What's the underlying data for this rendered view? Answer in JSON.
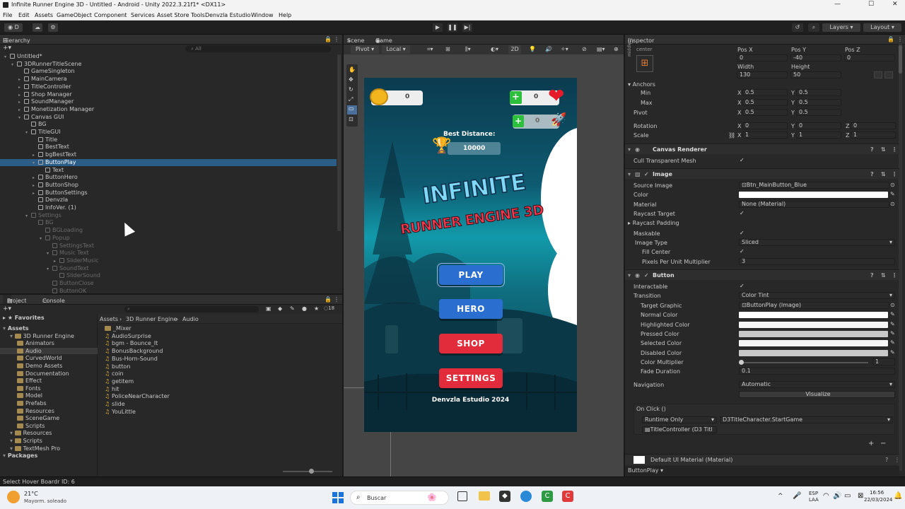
{
  "window": {
    "title": "Infinite Runner Engine 3D - Untitled - Android - Unity 2022.3.21f1* <DX11>"
  },
  "menu": [
    "File",
    "Edit",
    "Assets",
    "GameObject",
    "Component",
    "Services",
    "Asset Store Tools",
    "Denvzla Estudio",
    "Window",
    "Help"
  ],
  "toolbar": {
    "account_label": "D",
    "layers_label": "Layers",
    "layout_label": "Layout"
  },
  "hierarchy": {
    "tab": "Hierarchy",
    "search_placeholder": "All",
    "rows": [
      {
        "label": "Untitled*",
        "indent": 0,
        "arrow": "▾",
        "state": "normal"
      },
      {
        "label": "3DRunnerTitleScene",
        "indent": 1,
        "arrow": "▾",
        "state": "normal"
      },
      {
        "label": "GameSingleton",
        "indent": 2,
        "arrow": "",
        "state": "normal"
      },
      {
        "label": "MainCamera",
        "indent": 2,
        "arrow": "▸",
        "state": "normal"
      },
      {
        "label": "TitleController",
        "indent": 2,
        "arrow": "▸",
        "state": "normal"
      },
      {
        "label": "Shop Manager",
        "indent": 2,
        "arrow": "▸",
        "state": "normal"
      },
      {
        "label": "SoundManager",
        "indent": 2,
        "arrow": "▸",
        "state": "normal"
      },
      {
        "label": "Monetization Manager",
        "indent": 2,
        "arrow": "▸",
        "state": "normal"
      },
      {
        "label": "Canvas GUI",
        "indent": 2,
        "arrow": "▾",
        "state": "normal"
      },
      {
        "label": "BG",
        "indent": 3,
        "arrow": "",
        "state": "normal"
      },
      {
        "label": "TitleGUI",
        "indent": 3,
        "arrow": "▾",
        "state": "normal"
      },
      {
        "label": "Title",
        "indent": 4,
        "arrow": "",
        "state": "normal"
      },
      {
        "label": "BestText",
        "indent": 4,
        "arrow": "",
        "state": "normal"
      },
      {
        "label": "bgBestText",
        "indent": 4,
        "arrow": "▸",
        "state": "normal"
      },
      {
        "label": "ButtonPlay",
        "indent": 4,
        "arrow": "▾",
        "state": "selected"
      },
      {
        "label": "Text",
        "indent": 5,
        "arrow": "",
        "state": "normal"
      },
      {
        "label": "ButtonHero",
        "indent": 4,
        "arrow": "▸",
        "state": "normal"
      },
      {
        "label": "ButtonShop",
        "indent": 4,
        "arrow": "▸",
        "state": "normal"
      },
      {
        "label": "ButtonSettings",
        "indent": 4,
        "arrow": "▸",
        "state": "normal"
      },
      {
        "label": "Denvzla",
        "indent": 4,
        "arrow": "",
        "state": "normal"
      },
      {
        "label": "InfoVer. (1)",
        "indent": 4,
        "arrow": "",
        "state": "normal"
      },
      {
        "label": "Settings",
        "indent": 3,
        "arrow": "▾",
        "state": "dim"
      },
      {
        "label": "BG",
        "indent": 4,
        "arrow": "",
        "state": "dim"
      },
      {
        "label": "BGLoading",
        "indent": 5,
        "arrow": "",
        "state": "dim"
      },
      {
        "label": "Popup",
        "indent": 5,
        "arrow": "▾",
        "state": "dim"
      },
      {
        "label": "SettingsText",
        "indent": 6,
        "arrow": "",
        "state": "dim"
      },
      {
        "label": "Music Text",
        "indent": 6,
        "arrow": "▾",
        "state": "dim"
      },
      {
        "label": "SliderMusic",
        "indent": 7,
        "arrow": "▸",
        "state": "dim"
      },
      {
        "label": "SoundText",
        "indent": 6,
        "arrow": "▾",
        "state": "dim"
      },
      {
        "label": "SliderSound",
        "indent": 7,
        "arrow": "",
        "state": "dim"
      },
      {
        "label": "ButtonClose",
        "indent": 6,
        "arrow": "",
        "state": "dim"
      },
      {
        "label": "ButtonOK",
        "indent": 6,
        "arrow": "",
        "state": "dim"
      }
    ]
  },
  "project": {
    "tabs": [
      "Project",
      "Console"
    ],
    "badge": "18",
    "favorites": "Favorites",
    "tree": [
      {
        "label": "Assets",
        "indent": 0,
        "bold": true
      },
      {
        "label": "3D Runner Engine",
        "indent": 1
      },
      {
        "label": "Animators",
        "indent": 2
      },
      {
        "label": "Audio",
        "indent": 2,
        "selected": true
      },
      {
        "label": "CurvedWorld",
        "indent": 2
      },
      {
        "label": "Demo Assets",
        "indent": 2
      },
      {
        "label": "Documentation",
        "indent": 2
      },
      {
        "label": "Effect",
        "indent": 2
      },
      {
        "label": "Fonts",
        "indent": 2
      },
      {
        "label": "Model",
        "indent": 2
      },
      {
        "label": "Prefabs",
        "indent": 2
      },
      {
        "label": "Resources",
        "indent": 2
      },
      {
        "label": "SceneGame",
        "indent": 2
      },
      {
        "label": "Scripts",
        "indent": 2
      },
      {
        "label": "Resources",
        "indent": 1
      },
      {
        "label": "Scripts",
        "indent": 1
      },
      {
        "label": "TextMesh Pro",
        "indent": 1
      },
      {
        "label": "Packages",
        "indent": 0,
        "bold": true
      }
    ],
    "breadcrumb": [
      "Assets",
      "3D Runner Engine",
      "Audio"
    ],
    "files": [
      {
        "label": "_Mixer",
        "folder": true
      },
      {
        "label": "AudioSurprise"
      },
      {
        "label": "bgm - Bounce_It"
      },
      {
        "label": "BonusBackground"
      },
      {
        "label": "Bus-Horn-Sound"
      },
      {
        "label": "button"
      },
      {
        "label": "coin"
      },
      {
        "label": "getitem"
      },
      {
        "label": "hit"
      },
      {
        "label": "PoliceNearCharacter"
      },
      {
        "label": "slide"
      },
      {
        "label": "YouLittle"
      }
    ]
  },
  "scene": {
    "tabs": [
      "Scene",
      "Game"
    ],
    "pivot": "Pivot",
    "local": "Local",
    "mode2d": "2D"
  },
  "game": {
    "coins": "0",
    "gems": "0",
    "lives": "0",
    "best_label": "Best Distance:",
    "best_value": "10000",
    "logo_line1": "INFINITE",
    "logo_line2": "RUNNER ENGINE 3D",
    "buttons": [
      {
        "label": "PLAY",
        "color": "#2a6fd0"
      },
      {
        "label": "HERO",
        "color": "#2a6fd0"
      },
      {
        "label": "SHOP",
        "color": "#e22b3b"
      },
      {
        "label": "SETTINGS",
        "color": "#e22b3b"
      }
    ],
    "footer": "Denvzla Estudio 2024"
  },
  "inspector": {
    "tab": "Inspector",
    "rect": {
      "anchor_label": "center",
      "side_label": "middle",
      "posx_label": "Pos X",
      "posy_label": "Pos Y",
      "posz_label": "Pos Z",
      "posx": "0",
      "posy": "-40",
      "posz": "0",
      "width_label": "Width",
      "height_label": "Height",
      "width": "130",
      "height": "50"
    },
    "anchors": {
      "label": "Anchors",
      "min_label": "Min",
      "max_label": "Max",
      "min_x": "0.5",
      "min_y": "0.5",
      "max_x": "0.5",
      "max_y": "0.5"
    },
    "pivot": {
      "label": "Pivot",
      "x": "0.5",
      "y": "0.5"
    },
    "rotation": {
      "label": "Rotation",
      "x": "0",
      "y": "0",
      "z": "0"
    },
    "scale": {
      "label": "Scale",
      "x": "1",
      "y": "1",
      "z": "1"
    },
    "canvas_renderer": {
      "title": "Canvas Renderer",
      "cull_label": "Cull Transparent Mesh"
    },
    "image": {
      "title": "Image",
      "source_label": "Source Image",
      "source_value": "Btn_MainButton_Blue",
      "color_label": "Color",
      "material_label": "Material",
      "material_value": "None (Material)",
      "raycast_target_label": "Raycast Target",
      "raycast_padding_label": "Raycast Padding",
      "maskable_label": "Maskable",
      "type_label": "Image Type",
      "type_value": "Sliced",
      "fill_center_label": "Fill Center",
      "ppu_label": "Pixels Per Unit Multiplier",
      "ppu_value": "3"
    },
    "button": {
      "title": "Button",
      "interactable_label": "Interactable",
      "transition_label": "Transition",
      "transition_value": "Color Tint",
      "target_label": "Target Graphic",
      "target_value": "ButtonPlay (Image)",
      "normal_label": "Normal Color",
      "highlighted_label": "Highlighted Color",
      "pressed_label": "Pressed Color",
      "selected_label": "Selected Color",
      "disabled_label": "Disabled Color",
      "multiplier_label": "Color Multiplier",
      "multiplier_value": "1",
      "fade_label": "Fade Duration",
      "fade_value": "0.1",
      "navigation_label": "Navigation",
      "navigation_value": "Automatic",
      "visualize_label": "Visualize"
    },
    "onclick": {
      "label": "On Click ()",
      "runtime": "Runtime Only",
      "function": "D3TitleCharacter.StartGame",
      "object": "TitleController (D3 Titl"
    },
    "material_footer": "Default UI Material (Material)",
    "footer_obj": "ButtonPlay"
  },
  "status": {
    "text": "Select Hover Boardr ID: 6"
  },
  "taskbar": {
    "weather_temp": "21°C",
    "weather_desc": "Mayorm. soleado",
    "search": "Buscar",
    "lang1": "ESP",
    "lang2": "LAA",
    "time": "16:56",
    "date": "22/03/2024"
  }
}
